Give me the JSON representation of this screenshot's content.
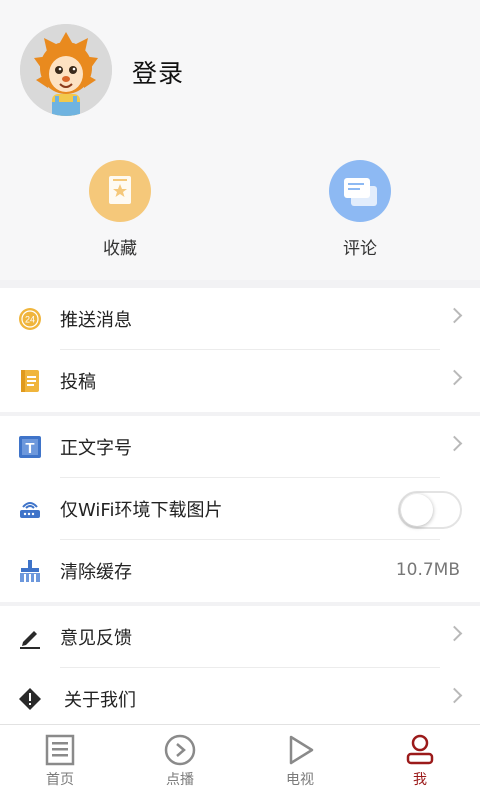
{
  "profile": {
    "login_label": "登录"
  },
  "quick_actions": {
    "favorites_label": "收藏",
    "comments_label": "评论"
  },
  "menu": {
    "push": "推送消息",
    "submit": "投稿",
    "font_size": "正文字号",
    "wifi_images": "仅WiFi环境下载图片",
    "clear_cache": "清除缓存",
    "cache_size": "10.7MB",
    "feedback": "意见反馈",
    "about": "关于我们",
    "wifi_toggle_on": false
  },
  "tabs": [
    {
      "label": "首页"
    },
    {
      "label": "点播"
    },
    {
      "label": "电视"
    },
    {
      "label": "我"
    }
  ],
  "colors": {
    "accent": "#9b1a1a",
    "orange": "#f5c87a",
    "blue": "#8db9f3",
    "icon_blue": "#3f74c9"
  }
}
